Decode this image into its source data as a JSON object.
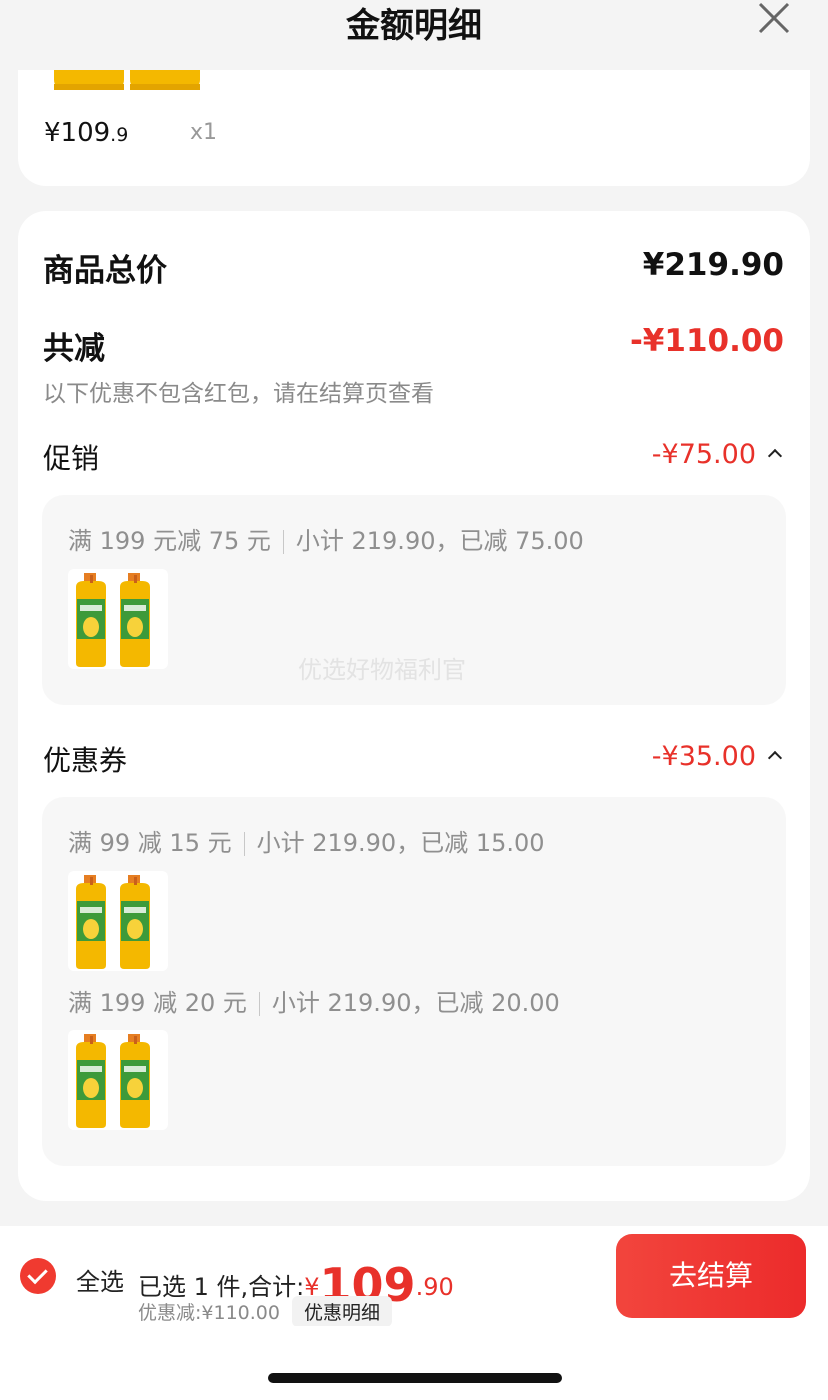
{
  "header": {
    "title": "金额明细"
  },
  "item": {
    "price_int": "¥109",
    "price_dec": ".9",
    "qty": "x1"
  },
  "summary": {
    "goods_total_label": "商品总价",
    "goods_total_value": "¥219.90",
    "discount_label": "共减",
    "discount_value": "-¥110.00",
    "note": "以下优惠不包含红包，请在结算页查看"
  },
  "promotion": {
    "label": "促销",
    "value": "-¥75.00",
    "rules": [
      {
        "title": "满 199 元减 75 元",
        "detail": "小计 219.90，已减 75.00"
      }
    ],
    "watermark": "优选好物福利官"
  },
  "coupon": {
    "label": "优惠券",
    "value": "-¥35.00",
    "rules": [
      {
        "title": "满 99 减 15 元",
        "detail": "小计 219.90，已减 15.00"
      },
      {
        "title": "满 199 减 20 元",
        "detail": "小计 219.90，已减 20.00"
      }
    ]
  },
  "bottom_bar": {
    "select_all": "全选",
    "selected_text": "已选 1 件,合计:",
    "currency": "¥",
    "total_int": "109",
    "total_dec": ".90",
    "saved_text": "优惠减:¥110.00",
    "detail_button": "优惠明细",
    "checkout_button": "去结算"
  },
  "colors": {
    "accent_red": "#e8312a",
    "bottle_yellow": "#f4b800",
    "cap_orange": "#e67e22"
  },
  "icons": [
    "close-icon",
    "check-circle-icon",
    "caret-up-icon",
    "oil-bottle-image"
  ]
}
